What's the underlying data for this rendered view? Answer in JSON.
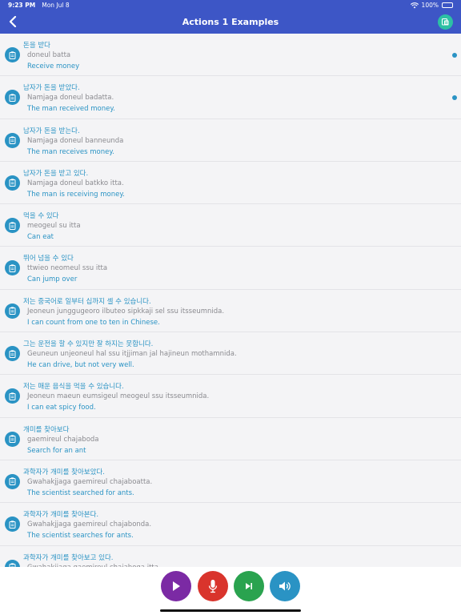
{
  "status": {
    "time": "9:23 PM",
    "date": "Mon Jul 8",
    "battery": "100%"
  },
  "nav": {
    "title": "Actions 1 Examples"
  },
  "rows": [
    {
      "korean": "돈을 받다",
      "roman": "doneul batta",
      "english": "Receive money",
      "dot": true
    },
    {
      "korean": "남자가 돈을 받았다.",
      "roman": "Namjaga doneul badatta.",
      "english": "The man received money.",
      "dot": true
    },
    {
      "korean": "남자가 돈을 받는다.",
      "roman": "Namjaga doneul banneunda",
      "english": "The man receives money.",
      "dot": false
    },
    {
      "korean": "남자가 돈을 받고 있다.",
      "roman": "Namjaga doneul batkko itta.",
      "english": "The man is receiving money.",
      "dot": false
    },
    {
      "korean": "먹을 수 있다",
      "roman": "meogeul su itta",
      "english": "Can eat",
      "dot": false
    },
    {
      "korean": "뛰어 넘을 수 있다",
      "roman": "ttwieo neomeul ssu itta",
      "english": "Can jump over",
      "dot": false
    },
    {
      "korean": "저는 중국어로 일부터 십까지 셀 수 있습니다.",
      "roman": "Jeoneun junggugeoro ilbuteo sipkkaji sel ssu itsseumnida.",
      "english": "I can count from one to ten in Chinese.",
      "dot": false
    },
    {
      "korean": "그는 운전을 할 수 있지만 잘 하지는 못합니다.",
      "roman": "Geuneun unjeoneul hal ssu itjjiman jal hajineun mothamnida.",
      "english": "He can drive, but not very well.",
      "dot": false
    },
    {
      "korean": "저는 매운 음식을 먹을 수 있습니다.",
      "roman": "Jeoneun maeun eumsigeul meogeul ssu itsseumnida.",
      "english": "I can eat spicy food.",
      "dot": false
    },
    {
      "korean": "개미를 찾아보다",
      "roman": "gaemireul chajaboda",
      "english": "Search for an ant",
      "dot": false
    },
    {
      "korean": "과학자가 개미를 찾아보았다.",
      "roman": "Gwahakjjaga gaemireul chajaboatta.",
      "english": "The scientist searched for ants.",
      "dot": false
    },
    {
      "korean": "과학자가 개미를 찾아본다.",
      "roman": "Gwahakjjaga gaemireul chajabonda.",
      "english": "The scientist searches for ants.",
      "dot": false
    },
    {
      "korean": "과학자가 개미를 찾아보고 있다.",
      "roman": "Gwahakjjaga gaemireul chajaboga itta.",
      "english": "",
      "dot": false
    }
  ],
  "colors": {
    "header": "#3d56c6",
    "accent": "#2a93c4",
    "play": "#7b2aa4",
    "mic": "#d9342c",
    "next": "#2aa34f",
    "speaker": "#2a93c4",
    "copy_all": "#2cc0a4"
  },
  "icons": {
    "back": "chevron-left-icon",
    "copy_all": "copy-all-icon",
    "row": "clipboard-icon",
    "play": "play-icon",
    "mic": "microphone-icon",
    "next": "skip-next-icon",
    "speaker": "speaker-icon"
  }
}
